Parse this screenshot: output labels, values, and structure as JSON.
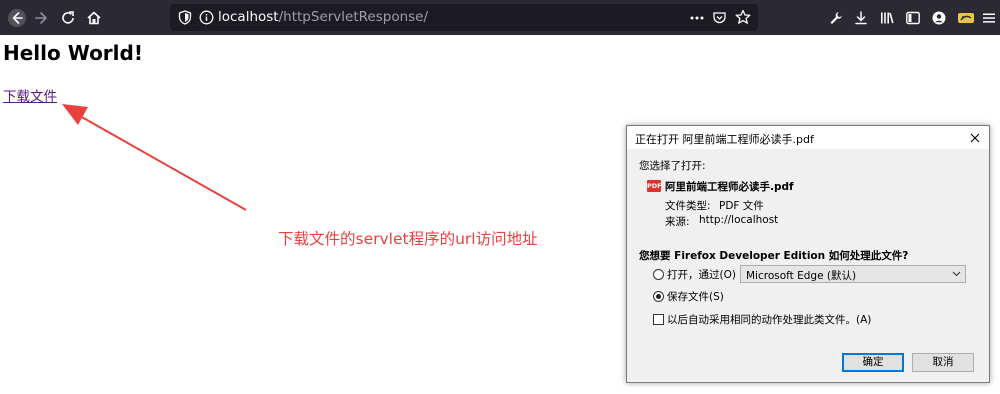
{
  "browser": {
    "url_host": "localhost",
    "url_path": "/httpServletResponse/",
    "back_icon": "back-arrow-icon",
    "forward_icon": "forward-arrow-icon",
    "reload_icon": "reload-icon",
    "home_icon": "home-icon"
  },
  "page": {
    "title": "Hello World!",
    "download_link": "下载文件"
  },
  "annotation": {
    "text": "下载文件的servlet程序的url访问地址",
    "color": "#e8423f"
  },
  "dialog": {
    "title": "正在打开 阿里前端工程师必读手.pdf",
    "chosen_label": "您选择了打开:",
    "file_name": "阿里前端工程师必读手.pdf",
    "file_type_label": "文件类型:",
    "file_type_value": "PDF 文件",
    "source_label": "来源:",
    "source_value": "http://localhost",
    "question": "您想要 Firefox Developer Edition 如何处理此文件?",
    "open_with_label": "打开，通过(O)",
    "open_with_app": "Microsoft Edge (默认)",
    "save_label": "保存文件(S)",
    "auto_label": "以后自动采用相同的动作处理此类文件。(A)",
    "ok_label": "确定",
    "cancel_label": "取消",
    "save_selected": true,
    "auto_checked": false
  },
  "colors": {
    "toolbar_bg": "#2b2a33",
    "urlbar_bg": "#1c1b22",
    "link": "#551a8b",
    "accent": "#0078d7"
  }
}
